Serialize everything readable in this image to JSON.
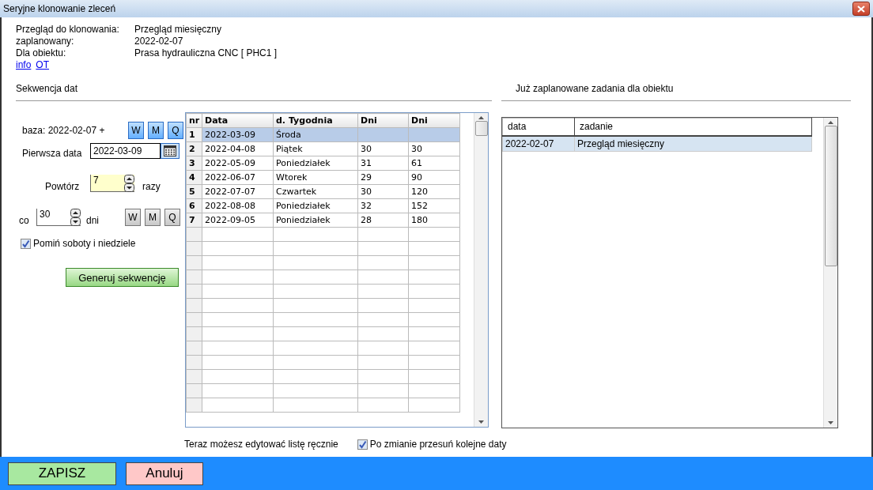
{
  "window": {
    "title": "Seryjne klonowanie zleceń"
  },
  "info": [
    {
      "label": "Przegląd do klonowania:",
      "value": "Przegląd miesięczny"
    },
    {
      "label": "zaplanowany:",
      "value": "2022-02-07"
    },
    {
      "label": "Dla obiektu:",
      "value": "Prasa hydrauliczna CNC [ PHC1 ]"
    }
  ],
  "links": [
    "info",
    "OT"
  ],
  "sequence": {
    "title": "Sekwencja dat",
    "base_label": "baza: 2022-02-07 +",
    "base_buttons": [
      "W",
      "M",
      "Q"
    ],
    "first_date": {
      "label": "Pierwsza data",
      "value": "2022-03-09"
    },
    "repeat": {
      "label": "Powtórz",
      "value": "7",
      "unit": "razy"
    },
    "interval": {
      "label": "co",
      "value": "30",
      "unit": "dni",
      "buttons": [
        "W",
        "M",
        "Q"
      ]
    },
    "skip_weekends": {
      "label": "Pomiń soboty i niedziele",
      "checked": true
    },
    "generate_button": "Generuj sekwencję"
  },
  "table": {
    "columns": [
      "nr",
      "Data",
      "d. Tygodnia",
      "Dni",
      "Dni"
    ],
    "rows": [
      {
        "cells": [
          "1",
          "2022-03-09",
          "Środa"
        ],
        "selected": true
      },
      {
        "cells": [
          "2",
          "2022-04-08",
          "Piątek",
          "30",
          "30"
        ],
        "selected": false
      },
      {
        "cells": [
          "3",
          "2022-05-09",
          "Poniedziałek",
          "31",
          "61"
        ],
        "selected": false
      },
      {
        "cells": [
          "4",
          "2022-06-07",
          "Wtorek",
          "29",
          "90"
        ],
        "selected": false
      },
      {
        "cells": [
          "5",
          "2022-07-07",
          "Czwartek",
          "30",
          "120"
        ],
        "selected": false
      },
      {
        "cells": [
          "6",
          "2022-08-08",
          "Poniedziałek",
          "32",
          "152"
        ],
        "selected": false
      },
      {
        "cells": [
          "7",
          "2022-09-05",
          "Poniedziałek",
          "28",
          "180"
        ],
        "selected": false
      }
    ]
  },
  "edit_hint": "Teraz możesz edytować listę ręcznie",
  "shift_dates": {
    "label": "Po zmianie przesuń kolejne daty",
    "checked": true
  },
  "scheduled": {
    "title": "Już zaplanowane zadania dla obiektu",
    "columns": [
      "data",
      "zadanie"
    ],
    "rows": [
      {
        "cells": [
          "2022-02-07",
          "Przegląd miesięczny"
        ],
        "selected": true
      }
    ]
  },
  "buttons": [
    {
      "label": "ZAPISZ",
      "kind": "save"
    },
    {
      "label": "Anuluj",
      "kind": "cancel"
    }
  ]
}
